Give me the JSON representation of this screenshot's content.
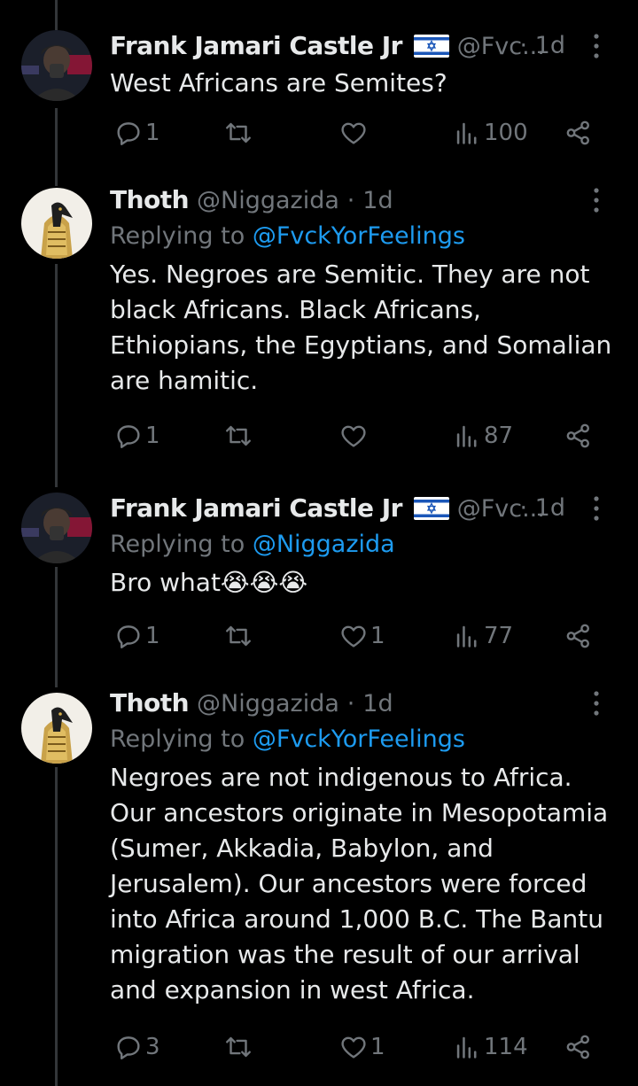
{
  "tweets": [
    {
      "name": "Frank Jamari Castle Jr",
      "handle": "@Fvc...",
      "dot": "·",
      "time": "1d",
      "reply_prefix": "",
      "reply_to": "",
      "text": "West Africans are Semites?",
      "replies": "1",
      "retweets": "",
      "likes": "",
      "views": "100"
    },
    {
      "name": "Thoth",
      "handle": "@Niggazida",
      "dot": "·",
      "time": "1d",
      "reply_prefix": "Replying to ",
      "reply_to": "@FvckYorFeelings",
      "text": "Yes. Negroes are Semitic. They are not black Africans. Black Africans, Ethiopians, the Egyptians, and Somalian are hamitic.",
      "replies": "1",
      "retweets": "",
      "likes": "",
      "views": "87"
    },
    {
      "name": "Frank Jamari Castle Jr",
      "handle": "@Fvc...",
      "dot": "·",
      "time": "1d",
      "reply_prefix": "Replying to ",
      "reply_to": "@Niggazida",
      "text": "Bro what😭😭😭",
      "replies": "1",
      "retweets": "",
      "likes": "1",
      "views": "77"
    },
    {
      "name": "Thoth",
      "handle": "@Niggazida",
      "dot": "·",
      "time": "1d",
      "reply_prefix": "Replying to ",
      "reply_to": "@FvckYorFeelings",
      "text": "Negroes are not indigenous to Africa. Our ancestors originate in Mesopotamia (Sumer, Akkadia, Babylon, and Jerusalem). Our ancestors were forced into Africa around 1,000 B.C. The Bantu migration was the result of our arrival and expansion in west Africa.",
      "replies": "3",
      "retweets": "",
      "likes": "1",
      "views": "114"
    }
  ],
  "colors": {
    "background": "#000000",
    "text": "#e7e9ea",
    "muted": "#71767b",
    "link": "#1d9bf0",
    "thread_line": "#333639"
  },
  "icons": [
    "reply-icon",
    "retweet-icon",
    "like-icon",
    "views-icon",
    "share-icon",
    "more-icon",
    "israel-flag-icon"
  ]
}
